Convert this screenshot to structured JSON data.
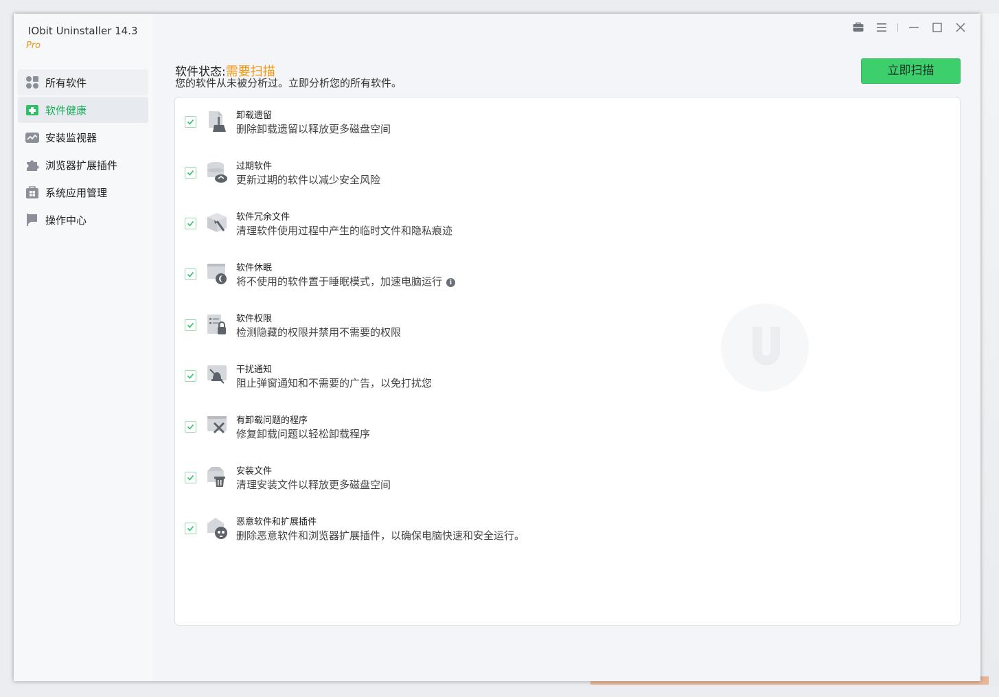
{
  "app": {
    "title": "IObit Uninstaller 14.3",
    "edition": "Pro"
  },
  "sidebar": {
    "items": [
      {
        "label": "所有软件",
        "icon": "grid-apps-icon"
      },
      {
        "label": "软件健康",
        "icon": "health-plus-icon"
      },
      {
        "label": "安装监视器",
        "icon": "monitor-chart-icon"
      },
      {
        "label": "浏览器扩展插件",
        "icon": "puzzle-icon"
      },
      {
        "label": "系统应用管理",
        "icon": "windows-bag-icon"
      },
      {
        "label": "操作中心",
        "icon": "flag-icon"
      }
    ]
  },
  "header": {
    "status_label": "软件状态:",
    "status_value": "需要扫描",
    "subtitle": "您的软件从未被分析过。立即分析您的所有软件。",
    "scan_button": "立即扫描"
  },
  "items": [
    {
      "title": "卸载遗留",
      "desc": "删除卸载遗留以释放更多磁盘空间",
      "icon": "leftover-broom-icon",
      "checked": true
    },
    {
      "title": "过期软件",
      "desc": "更新过期的软件以减少安全风险",
      "icon": "outdated-cloud-icon",
      "checked": true
    },
    {
      "title": "软件冗余文件",
      "desc": "清理软件使用过程中产生的临时文件和隐私痕迹",
      "icon": "junk-brush-icon",
      "checked": true
    },
    {
      "title": "软件休眠",
      "desc": "将不使用的软件置于睡眠模式，加速电脑运行",
      "icon": "sleep-moon-icon",
      "checked": true,
      "info": true
    },
    {
      "title": "软件权限",
      "desc": "检测隐藏的权限并禁用不需要的权限",
      "icon": "permission-lock-icon",
      "checked": true
    },
    {
      "title": "干扰通知",
      "desc": "阻止弹窗通知和不需要的广告，以免打扰您",
      "icon": "bell-off-icon",
      "checked": true
    },
    {
      "title": "有卸载问题的程序",
      "desc": "修复卸载问题以轻松卸载程序",
      "icon": "repair-tools-icon",
      "checked": true
    },
    {
      "title": "安装文件",
      "desc": "清理安装文件以释放更多磁盘空间",
      "icon": "installer-trash-icon",
      "checked": true
    },
    {
      "title": "恶意软件和扩展插件",
      "desc": "删除恶意软件和浏览器扩展插件，以确保电脑快速和安全运行。",
      "icon": "malware-skull-icon",
      "checked": true
    }
  ],
  "colors": {
    "accent_green": "#3ccf6c",
    "status_orange": "#f39a0f",
    "active_nav": "#1aac5a"
  }
}
